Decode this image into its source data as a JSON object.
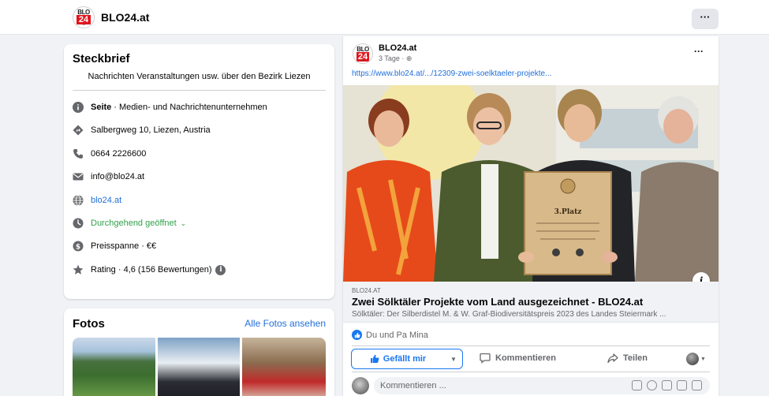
{
  "page": {
    "name": "BLO24.at"
  },
  "logo": {
    "top": "BLO",
    "num": "24",
    "sub": ".at"
  },
  "topbar": {
    "more_label": "···"
  },
  "intro": {
    "title": "Steckbrief",
    "bio": "Nachrichten Veranstaltungen usw. über den Bezirk Liezen",
    "category_label": "Seite",
    "category": " · Medien- und Nachrichtenunternehmen",
    "address": "Salbergweg 10, Liezen, Austria",
    "phone": "0664 2226600",
    "email": "info@blo24.at",
    "website": "blo24.at",
    "hours": "Durchgehend geöffnet",
    "hours_chevron": "⌄",
    "price": "Preisspanne · €€",
    "rating": "Rating · 4,6 (156 Bewertungen)",
    "rating_info": "i"
  },
  "photos": {
    "title": "Fotos",
    "see_all": "Alle Fotos ansehen"
  },
  "post": {
    "author": "BLO24.at",
    "meta": "3 Tage · ⊕",
    "more": "···",
    "url": "https://www.blo24.at/.../12309-zwei-soelktaeler-projekte...",
    "photo_info": "i",
    "certificate_label": "3.Platz",
    "preview": {
      "domain": "BLO24.AT",
      "title": "Zwei Sölktäler Projekte vom Land ausgezeichnet - BLO24.at",
      "desc": "Sölktäler: Der Silberdistel M. & W. Graf-Biodiversitätspreis 2023 des Landes Steiermark ..."
    },
    "reactions_text": "Du und Pa Mina",
    "like_label": "Gefällt mir",
    "like_caret": "▼",
    "comment_label": "Kommentieren",
    "share_label": "Teilen",
    "audience_caret": "▼",
    "comment_placeholder": "Kommentieren ..."
  },
  "colors": {
    "accent": "#1877f2",
    "link": "#216fdb",
    "open": "#31a24c",
    "brand_red": "#e3141b"
  }
}
